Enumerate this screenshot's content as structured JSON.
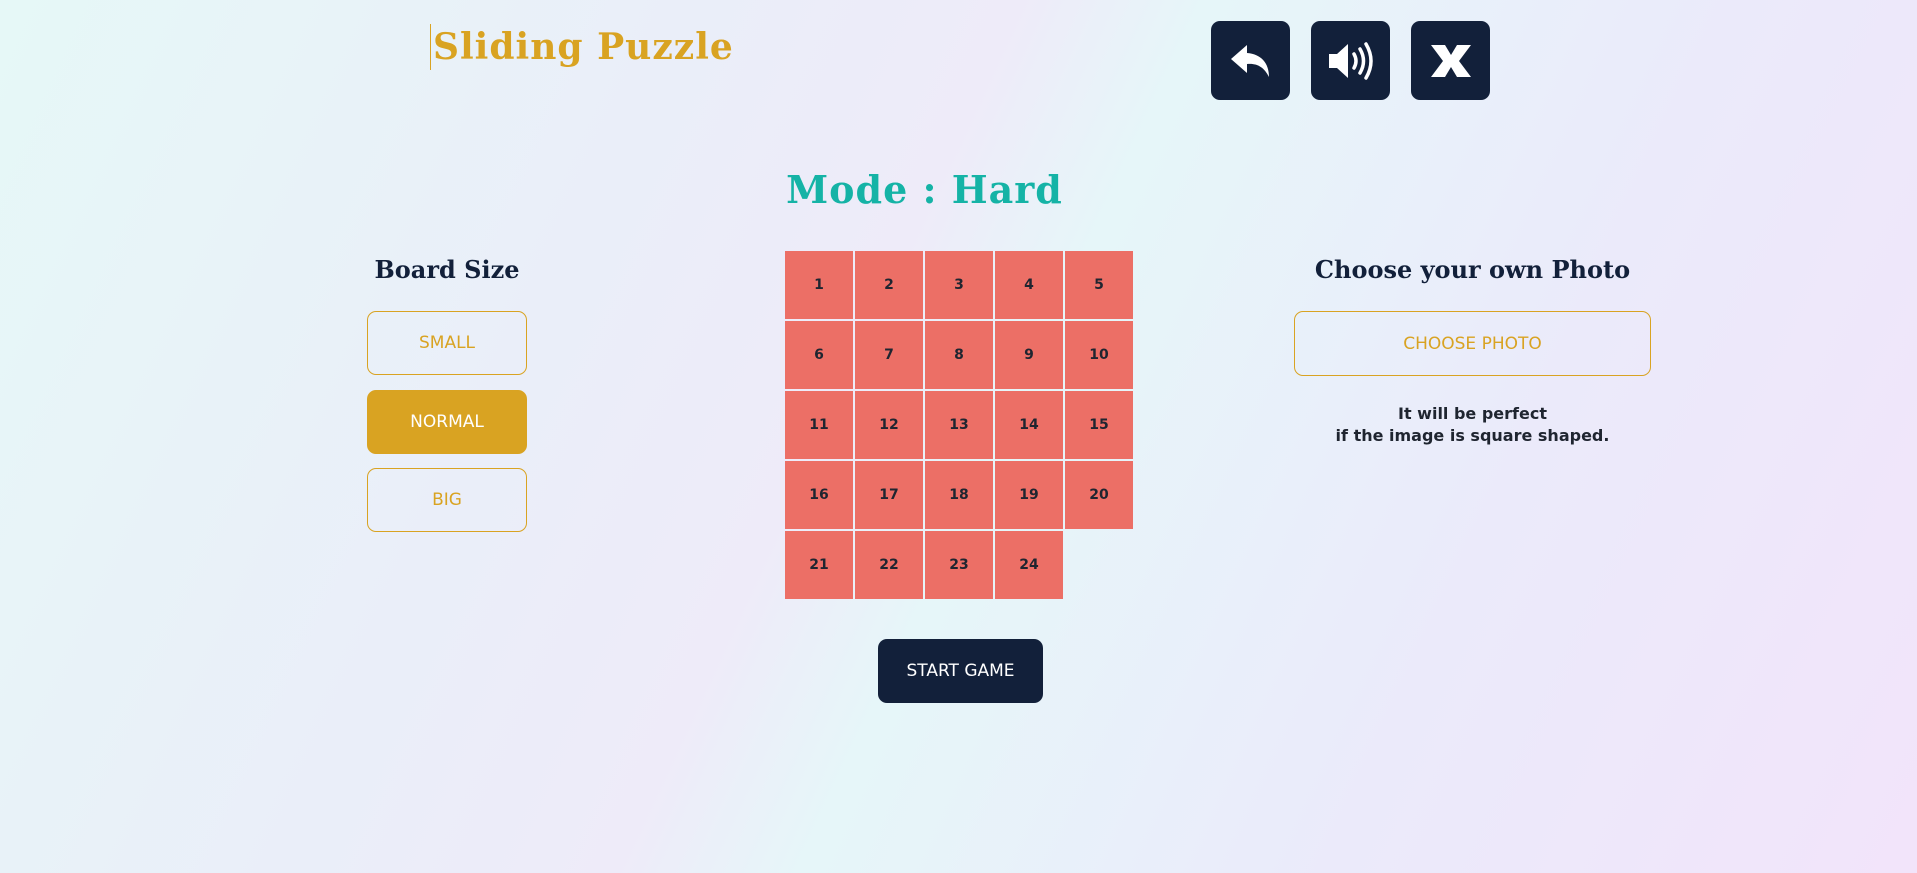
{
  "app": {
    "title": "Sliding Puzzle"
  },
  "toolbar": {
    "buttons": [
      {
        "icon": "back-arrow-icon"
      },
      {
        "icon": "speaker-icon"
      },
      {
        "icon": "close-icon"
      }
    ]
  },
  "mode": {
    "label": "Mode : Hard"
  },
  "board_size": {
    "heading": "Board Size",
    "options": [
      "SMALL",
      "NORMAL",
      "BIG"
    ],
    "selected": "NORMAL"
  },
  "board": {
    "rows": 5,
    "cols": 5,
    "tiles": [
      "1",
      "2",
      "3",
      "4",
      "5",
      "6",
      "7",
      "8",
      "9",
      "10",
      "11",
      "12",
      "13",
      "14",
      "15",
      "16",
      "17",
      "18",
      "19",
      "20",
      "21",
      "22",
      "23",
      "24",
      ""
    ]
  },
  "start": {
    "label": "START GAME"
  },
  "photo": {
    "heading": "Choose your own Photo",
    "button_label": "CHOOSE PHOTO",
    "note_line1": "It will be perfect",
    "note_line2": "if the image is square shaped."
  },
  "colors": {
    "title": "#d9a322",
    "mode": "#15b3a6",
    "navy": "#12203a",
    "accent": "#d9a322",
    "tile": "#ec6f66",
    "tile_text": "#1f2530",
    "white": "#ffffff"
  }
}
